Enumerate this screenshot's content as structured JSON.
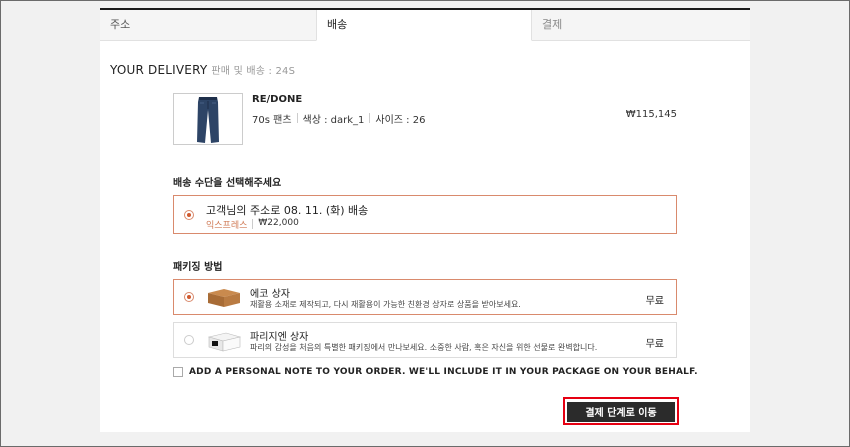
{
  "tabs": [
    {
      "label": "주소"
    },
    {
      "label": "배송"
    },
    {
      "label": "결제"
    }
  ],
  "section": {
    "title": "YOUR DELIVERY",
    "subtitle": "판매 및 배송 : 24S"
  },
  "product": {
    "brand": "RE/DONE",
    "name": "70s 팬츠",
    "color": "색상 : dark_1",
    "size": "사이즈 : 26",
    "price": "₩115,145",
    "image": "jeans-icon"
  },
  "delivery": {
    "heading": "배송 수단을 선택해주세요",
    "option": {
      "label": "고객님의 주소로 08. 11. (화) 배송",
      "method": "익스프레스",
      "fee": "₩22,000",
      "selected": true
    }
  },
  "packaging": {
    "heading": "패키징 방법",
    "options": [
      {
        "name": "에코 상자",
        "desc": "재활용 소재로 제작되고, 다시 재활용이 가능한 친환경 상자로 상품을 받아보세요.",
        "price": "무료",
        "selected": true,
        "icon": "kraft-box-icon"
      },
      {
        "name": "파리지엔 상자",
        "desc": "파리의 감성을 처음의 특별한 패키징에서 만나보세요. 소중한 사람, 혹은 자신을 위한 선물로 완벽합니다.",
        "price": "무료",
        "selected": false,
        "icon": "white-gift-box-icon"
      }
    ]
  },
  "note": {
    "label": "ADD A PERSONAL NOTE TO YOUR ORDER. WE'LL INCLUDE IT IN YOUR PACKAGE ON YOUR BEHALF.",
    "checked": false
  },
  "cta": {
    "label": "결제 단계로 이동"
  },
  "colors": {
    "accent": "#d05a2f",
    "selected_border": "#d98a6d",
    "button_bg": "#2b2b2b",
    "highlight": "#e60012"
  }
}
